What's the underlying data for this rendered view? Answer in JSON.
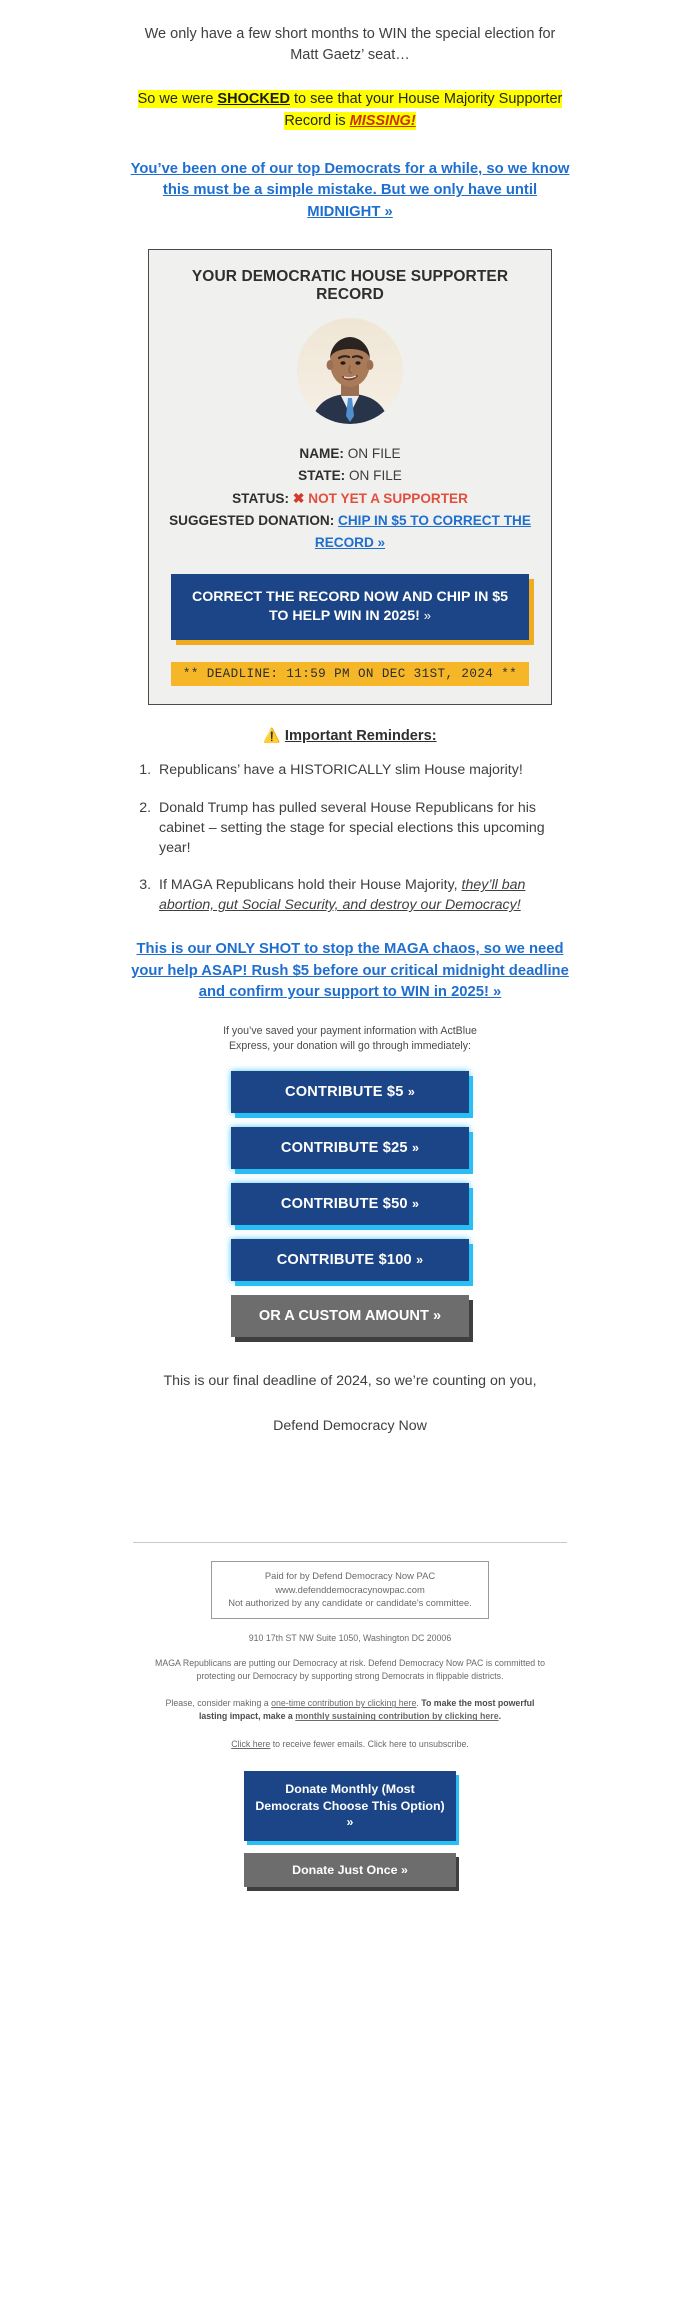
{
  "intro": {
    "paragraph": "We only have a few short months to WIN the special election for Matt Gaetz’ seat…"
  },
  "shock": {
    "prefix": "So we were ",
    "bold": "SHOCKED",
    "middle": " to see that your House Majority Supporter Record is ",
    "missing": "MISSING!"
  },
  "primary_link": {
    "text": "You’ve been one of our top Democrats for a while, so we know this must be a simple mistake. But we only have until MIDNIGHT »"
  },
  "record_card": {
    "title": "YOUR DEMOCRATIC HOUSE SUPPORTER RECORD",
    "portrait_alt": "hakeem-jeffries-portrait",
    "rows": [
      {
        "label": "NAME:",
        "value": "ON FILE"
      },
      {
        "label": "STATE:",
        "value": "ON FILE"
      }
    ],
    "status_label": "STATUS:",
    "status_icon": "red-x-icon",
    "status_value": "NOT YET A SUPPORTER",
    "suggested_label": "SUGGESTED DONATION:",
    "suggested_link": "CHIP IN $5 TO CORRECT THE RECORD »",
    "cta_button": "CORRECT THE RECORD NOW AND CHIP IN $5 TO HELP WIN IN 2025!",
    "cta_chevron": "»",
    "deadline": "** DEADLINE: 11:59 PM ON DEC 31ST, 2024 **"
  },
  "reminders": {
    "icon": "warning-triangle-icon",
    "title": "Important Reminders:",
    "items": [
      {
        "text": "Republicans’ have a HISTORICALLY slim House majority!"
      },
      {
        "text": "Donald Trump has pulled several House Republicans for his cabinet – setting the stage for special elections this upcoming year!"
      },
      {
        "prefix": "If MAGA Republicans hold their House Majority, ",
        "emphasis": "they’ll ban abortion, gut Social Security, and destroy our Democracy!"
      }
    ]
  },
  "ask_link": {
    "text": "This is our ONLY SHOT to stop the MAGA chaos, so we need your help ASAP! Rush $5 before our critical midnight deadline and confirm your support to WIN in 2025! »"
  },
  "actblue_note": {
    "text": "If you’ve saved your payment information with ActBlue Express, your donation will go through immediately:"
  },
  "contribute": {
    "buttons": [
      {
        "label": "CONTRIBUTE $5",
        "chevron": "»"
      },
      {
        "label": "CONTRIBUTE $25",
        "chevron": "»"
      },
      {
        "label": "CONTRIBUTE $50",
        "chevron": "»"
      },
      {
        "label": "CONTRIBUTE $100",
        "chevron": "»"
      }
    ],
    "custom": {
      "label": "OR A CUSTOM AMOUNT",
      "chevron": "»"
    }
  },
  "closing": {
    "line": "This is our final deadline of 2024, so we’re counting on you,",
    "signature": "Defend Democracy Now"
  },
  "footer": {
    "paid_for": [
      "Paid for by Defend Democracy Now PAC",
      "www.defenddemocracynowpac.com",
      "Not authorized by any candidate or candidate's committee."
    ],
    "address": "910 17th ST NW Suite 1050, Washington DC 20006",
    "mission": "MAGA Republicans are putting our Democracy at risk. Defend Democracy Now PAC is committed to protecting our Democracy by supporting strong Democrats in flippable districts.",
    "contribution_prefix": "Please, consider making a ",
    "onetime_link": "one-time contribution by clicking here",
    "contribution_middle": ". ",
    "contribution_bold_prefix": "To make the most powerful lasting impact, make a ",
    "monthly_link": "monthly sustaining contribution by clicking here",
    "contribution_bold_suffix": ".",
    "unsub_link": "Click here",
    "unsub_text": " to receive fewer emails. Click here to unsubscribe.",
    "donate_monthly": "Donate Monthly (Most Democrats Choose This Option) »",
    "donate_once": "Donate Just Once »"
  },
  "colors": {
    "brand_blue": "#1b4586",
    "link_blue": "#1f6fd0",
    "glow_cyan": "#29bff5",
    "gold": "#f0ab1f",
    "deadline_amber": "#f5b728",
    "highlight_yellow": "#ffff00",
    "alert_red": "#e1503e",
    "missing_orange": "#cc3300",
    "gray_button": "#6d6d6d"
  }
}
